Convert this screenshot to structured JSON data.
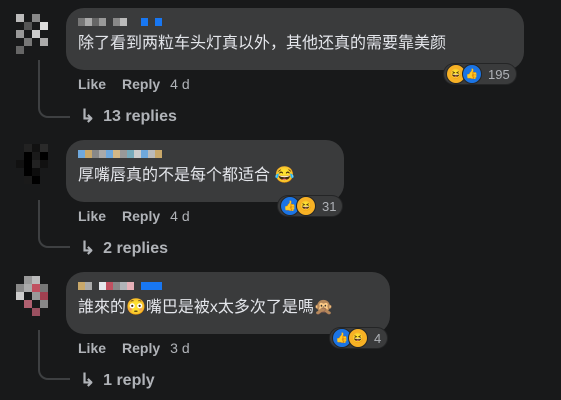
{
  "comments": [
    {
      "text": "除了看到两粒车头灯真以外，其他还真的需要靠美颜",
      "like_label": "Like",
      "reply_label": "Reply",
      "time": "4 d",
      "reactions": [
        "haha",
        "like"
      ],
      "reaction_count": "195",
      "replies": "13 replies"
    },
    {
      "text": "厚嘴唇真的不是每个都适合 😂",
      "like_label": "Like",
      "reply_label": "Reply",
      "time": "4 d",
      "reactions": [
        "like",
        "haha"
      ],
      "reaction_count": "31",
      "replies": "2 replies"
    },
    {
      "text": "誰來的😳嘴巴是被x太多次了是嗎🙊",
      "like_label": "Like",
      "reply_label": "Reply",
      "time": "3 d",
      "reactions": [
        "like",
        "haha"
      ],
      "reaction_count": "4",
      "replies": "1 reply"
    }
  ],
  "colors": {
    "background": "#18191a",
    "bubble": "#3a3b3c",
    "text": "#e4e6eb",
    "secondary": "#b0b3b8",
    "like": "#1b74e4",
    "haha": "#f7b125"
  }
}
